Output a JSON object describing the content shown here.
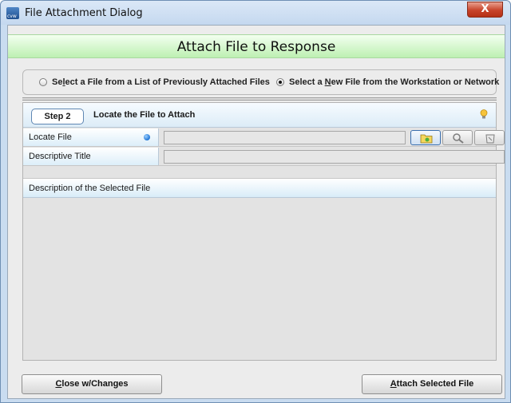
{
  "window": {
    "title": "File Attachment Dialog",
    "close_glyph": "X"
  },
  "header": {
    "title": "Attach File to Response"
  },
  "source": {
    "option1": {
      "pre": "Se",
      "mnemonic": "l",
      "post": "ect a File from a List of Previously Attached Files",
      "selected": false
    },
    "option2": {
      "pre": "Select a ",
      "mnemonic": "N",
      "post": "ew File from the Workstation or Network",
      "selected": true
    }
  },
  "step": {
    "pill": "Step 2",
    "title": "Locate the File to Attach",
    "hint_icon": "lightbulb-icon"
  },
  "fields": {
    "locate_label": "Locate File",
    "locate_value": "",
    "title_label": "Descriptive Title",
    "title_value": ""
  },
  "description": {
    "header": "Description of the Selected File",
    "value": ""
  },
  "buttons": {
    "close": {
      "mnemonic": "C",
      "post": "lose w/Changes"
    },
    "attach": {
      "mnemonic": "A",
      "post": "ttach Selected File"
    }
  },
  "colors": {
    "banner": "#bdf0b2",
    "required_dot": "#1e74d6"
  }
}
